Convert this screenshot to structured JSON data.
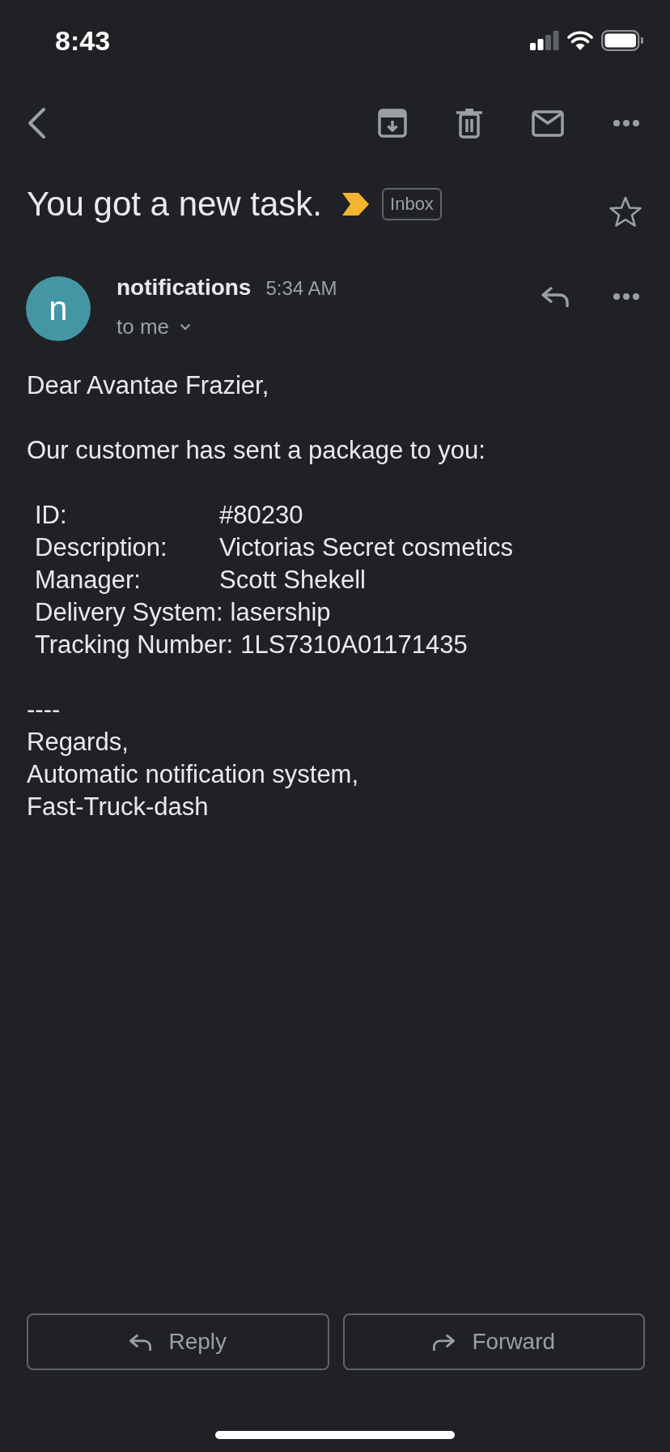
{
  "status_bar": {
    "time": "8:43"
  },
  "subject": {
    "title": "You got a new task.",
    "important": true,
    "label": "Inbox",
    "starred": false
  },
  "sender": {
    "initial": "n",
    "name": "notifications",
    "time": "5:34 AM",
    "recipient": "to me"
  },
  "message": {
    "greeting": "Dear Avantae Frazier,",
    "intro": "Our customer has sent a package to you:",
    "details": [
      {
        "label": "ID:",
        "value": "#80230",
        "kind": "tabbed"
      },
      {
        "label": "Description:",
        "value": "Victorias Secret cosmetics",
        "kind": "tabbed"
      },
      {
        "label": "Manager:",
        "value": "Scott Shekell",
        "kind": "tabbed"
      },
      {
        "label": "Delivery System:",
        "value": "lasership",
        "kind": "inline"
      },
      {
        "label": "Tracking Number:",
        "value": "1LS7310A01171435",
        "kind": "inline"
      }
    ],
    "separator": "----",
    "signature": [
      "Regards,",
      "Automatic notification system,",
      "Fast-Truck-dash"
    ]
  },
  "buttons": [
    {
      "label": "Reply",
      "kind": "reply"
    },
    {
      "label": "Forward",
      "kind": "forward"
    }
  ]
}
